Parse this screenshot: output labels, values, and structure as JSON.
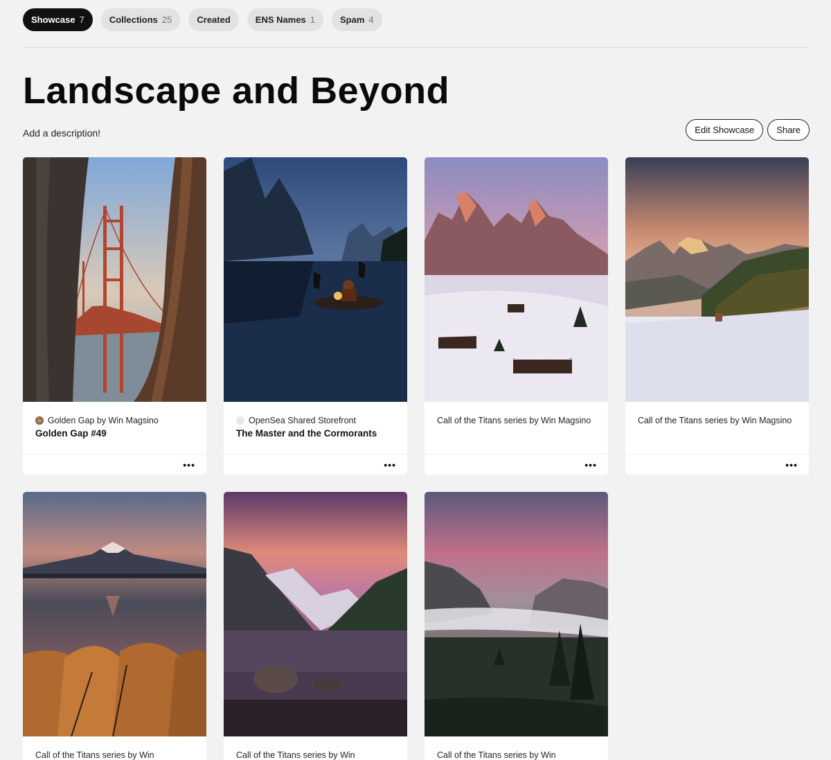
{
  "tabs": [
    {
      "label": "Showcase",
      "count": "7"
    },
    {
      "label": "Collections",
      "count": "25"
    },
    {
      "label": "Created",
      "count": ""
    },
    {
      "label": "ENS Names",
      "count": "1"
    },
    {
      "label": "Spam",
      "count": "4"
    }
  ],
  "page": {
    "title": "Landscape and Beyond",
    "description": "Add a description!"
  },
  "actions": {
    "edit_label": "Edit Showcase",
    "share_label": "Share"
  },
  "cards": [
    {
      "collection": "Golden Gap by Win Magsino",
      "name": "Golden Gap #49",
      "more": "•••"
    },
    {
      "collection": "OpenSea Shared Storefront",
      "name": "The Master and the Cormorants",
      "more": "•••"
    },
    {
      "collection": "Call of the Titans series by Win Magsino",
      "name": "",
      "more": "•••"
    },
    {
      "collection": "Call of the Titans series by Win Magsino",
      "name": "",
      "more": "•••"
    },
    {
      "collection": "Call of the Titans series by Win",
      "name": "",
      "more": ""
    },
    {
      "collection": "Call of the Titans series by Win",
      "name": "",
      "more": ""
    },
    {
      "collection": "Call of the Titans series by Win",
      "name": "",
      "more": ""
    }
  ],
  "colors": {
    "background": "#f2f2f2",
    "active_tab": "#111111",
    "tab": "#e2e2e2"
  }
}
